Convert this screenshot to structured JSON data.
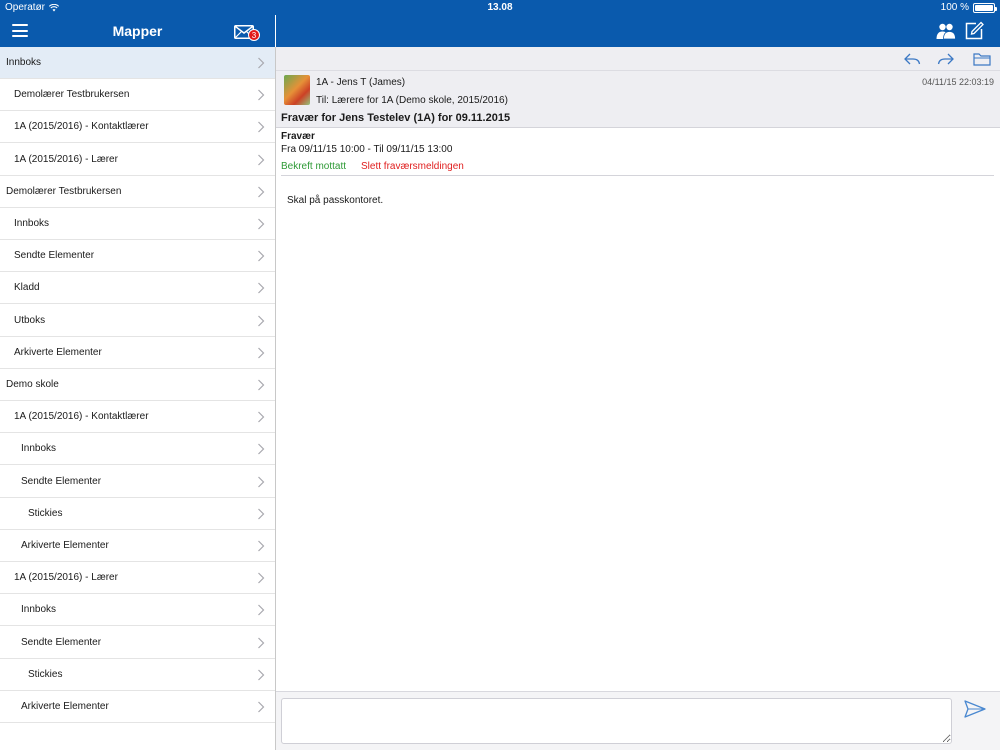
{
  "status_bar": {
    "carrier": "Operatør",
    "time": "13.08",
    "battery": "100 %"
  },
  "left_pane": {
    "title": "Mapper",
    "unread_badge": "3",
    "folders": [
      {
        "label": "Innboks",
        "indent": 0,
        "selected": true
      },
      {
        "label": "Demolærer Testbrukersen",
        "indent": 1
      },
      {
        "label": "1A (2015/2016) - Kontaktlærer",
        "indent": 1
      },
      {
        "label": "1A (2015/2016) - Lærer",
        "indent": 1
      },
      {
        "label": "Demolærer Testbrukersen",
        "indent": 0
      },
      {
        "label": "Innboks",
        "indent": 1
      },
      {
        "label": "Sendte Elementer",
        "indent": 1
      },
      {
        "label": "Kladd",
        "indent": 1
      },
      {
        "label": "Utboks",
        "indent": 1
      },
      {
        "label": "Arkiverte Elementer",
        "indent": 1
      },
      {
        "label": "Demo skole",
        "indent": 0
      },
      {
        "label": "1A (2015/2016) - Kontaktlærer",
        "indent": 1
      },
      {
        "label": "Innboks",
        "indent": 2
      },
      {
        "label": "Sendte Elementer",
        "indent": 2
      },
      {
        "label": "Stickies",
        "indent": 3
      },
      {
        "label": "Arkiverte Elementer",
        "indent": 2
      },
      {
        "label": "1A (2015/2016) - Lærer",
        "indent": 1
      },
      {
        "label": "Innboks",
        "indent": 2
      },
      {
        "label": "Sendte Elementer",
        "indent": 2
      },
      {
        "label": "Stickies",
        "indent": 3
      },
      {
        "label": "Arkiverte Elementer",
        "indent": 2
      }
    ]
  },
  "message": {
    "sender": "1A - Jens T (James)",
    "recipients": "Til: Lærere for 1A (Demo skole, 2015/2016)",
    "date": "04/11/15 22:03:19",
    "subject": "Fravær for Jens Testelev (1A) for 09.11.2015",
    "absence_title": "Fravær",
    "absence_period": "Fra 09/11/15 10:00 - Til 09/11/15 13:00",
    "confirm_label": "Bekreft mottatt",
    "delete_label": "Slett fraværsmeldingen",
    "body": "Skal på passkontoret."
  },
  "reply": {
    "placeholder": "",
    "value": ""
  },
  "icons": {
    "menu": "hamburger-icon",
    "mail": "envelope-icon",
    "people": "people-icon",
    "compose": "compose-icon",
    "reply": "reply-icon",
    "forward": "forward-icon",
    "folder": "folder-icon",
    "chevron": "chevron-right-icon",
    "send": "send-icon"
  },
  "colors": {
    "nav_bar": "#0a5aad",
    "selected_row": "#e3ecf6",
    "confirm": "#2e9a36",
    "delete": "#e01e1e",
    "badge": "#e21b1b"
  }
}
